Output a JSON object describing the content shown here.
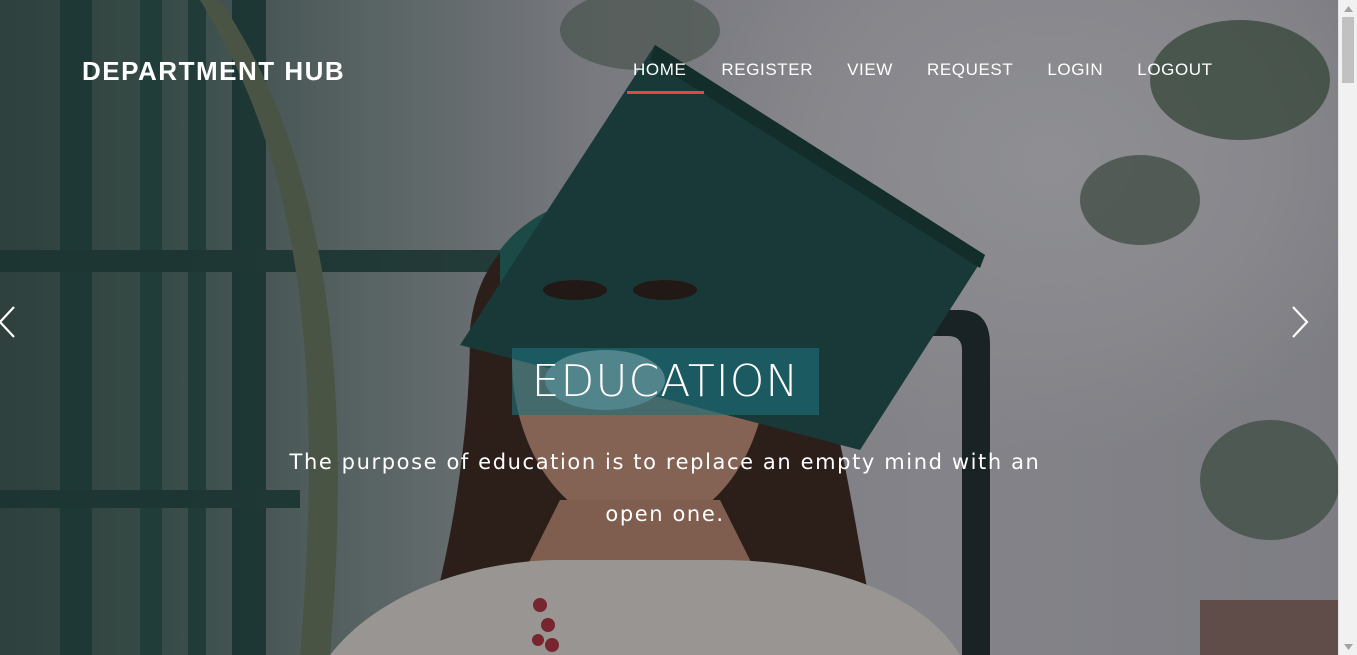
{
  "navbar": {
    "brand": "DEPARTMENT HUB",
    "items": [
      {
        "label": "HOME",
        "active": true
      },
      {
        "label": "REGISTER",
        "active": false
      },
      {
        "label": "VIEW",
        "active": false
      },
      {
        "label": "REQUEST",
        "active": false
      },
      {
        "label": "LOGIN",
        "active": false
      },
      {
        "label": "LOGOUT",
        "active": false
      }
    ],
    "active_underline_color": "#e0493c"
  },
  "carousel": {
    "title": "EDUCATION",
    "text": "The purpose of education is to replace an empty mind with an open one.",
    "title_background": "#1e707a",
    "prev_icon": "chevron-left-icon",
    "next_icon": "chevron-right-icon"
  },
  "colors": {
    "text": "#ffffff",
    "cap": "#1f5f58"
  }
}
